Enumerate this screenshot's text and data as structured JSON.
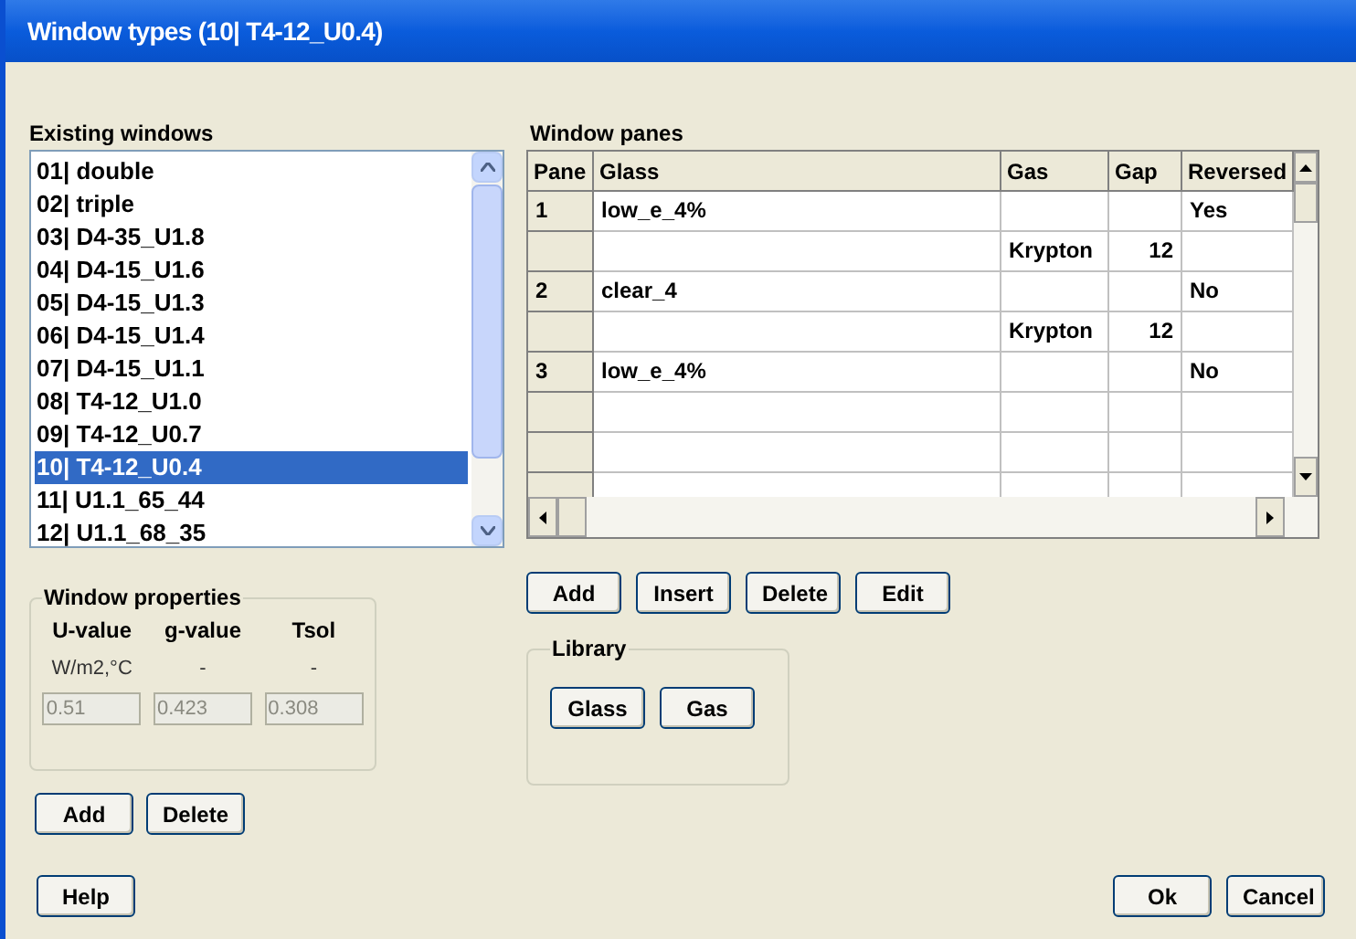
{
  "window": {
    "title": "Window types (10| T4-12_U0.4)"
  },
  "existing_windows": {
    "label": "Existing windows",
    "items": [
      {
        "label": "01| double",
        "selected": false
      },
      {
        "label": "02| triple",
        "selected": false
      },
      {
        "label": "03| D4-35_U1.8",
        "selected": false
      },
      {
        "label": "04| D4-15_U1.6",
        "selected": false
      },
      {
        "label": "05| D4-15_U1.3",
        "selected": false
      },
      {
        "label": "06| D4-15_U1.4",
        "selected": false
      },
      {
        "label": "07| D4-15_U1.1",
        "selected": false
      },
      {
        "label": "08| T4-12_U1.0",
        "selected": false
      },
      {
        "label": "09| T4-12_U0.7",
        "selected": false
      },
      {
        "label": "10| T4-12_U0.4",
        "selected": true
      },
      {
        "label": "11| U1.1_65_44",
        "selected": false
      },
      {
        "label": "12| U1.1_68_35",
        "selected": false
      }
    ]
  },
  "window_properties": {
    "label": "Window properties",
    "fields": [
      {
        "label": "U-value",
        "unit": "W/m2,°C",
        "value": "0.51",
        "disabled": true
      },
      {
        "label": "g-value",
        "unit": "-",
        "value": "0.423",
        "disabled": true
      },
      {
        "label": "Tsol",
        "unit": "-",
        "value": "0.308",
        "disabled": true
      }
    ]
  },
  "left_buttons": [
    "Add",
    "Delete"
  ],
  "window_panes": {
    "label": "Window panes",
    "columns": [
      "Pane",
      "Glass",
      "Gas",
      "Gap",
      "Reversed"
    ],
    "rows": [
      {
        "pane": "1",
        "glass": "low_e_4%",
        "reversed": "Yes"
      },
      {
        "gas": "Krypton",
        "gap": "12"
      },
      {
        "pane": "2",
        "glass": "clear_4",
        "reversed": "No"
      },
      {
        "gas": "Krypton",
        "gap": "12"
      },
      {
        "pane": "3",
        "glass": "low_e_4%",
        "reversed": "No"
      },
      {},
      {},
      {}
    ]
  },
  "pane_buttons": [
    "Add",
    "Insert",
    "Delete",
    "Edit"
  ],
  "library": {
    "label": "Library",
    "buttons": [
      "Glass",
      "Gas"
    ]
  },
  "footer_buttons": {
    "left": [
      "Help"
    ],
    "right": [
      "Ok",
      "Cancel"
    ]
  }
}
